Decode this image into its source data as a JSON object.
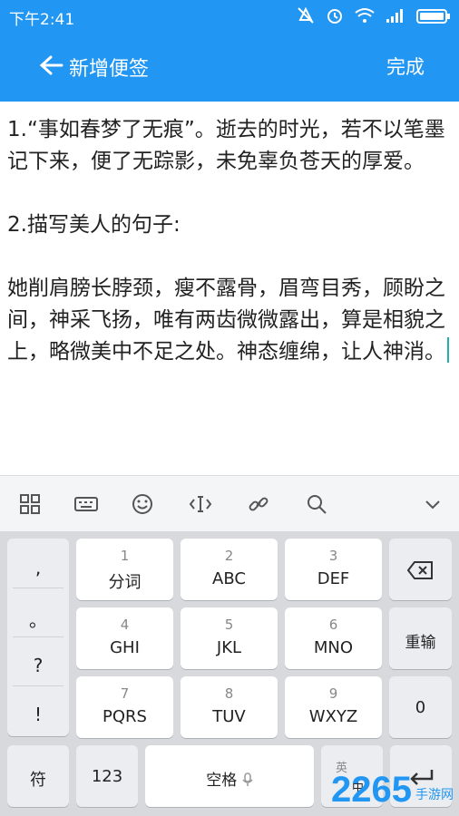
{
  "status_bar": {
    "time": "下午2:41"
  },
  "app_bar": {
    "title": "新增便签",
    "done_label": "完成"
  },
  "note": {
    "content": "1.“事如春梦了无痕”。逝去的时光，若不以笔墨记下来，便了无踪影，未免辜负苍天的厚爱。\n\n2.描写美人的句子:\n\n她削肩膀长脖颈，瘦不露骨，眉弯目秀，顾盼之间，神采飞扬，唯有两齿微微露出，算是相貌之上，略微美中不足之处。神态缠绵，让人神消。"
  },
  "keyboard": {
    "punct": [
      ",",
      "。",
      "?",
      "!"
    ],
    "rows": [
      [
        {
          "num": "1",
          "label": "分词"
        },
        {
          "num": "2",
          "label": "ABC"
        },
        {
          "num": "3",
          "label": "DEF"
        }
      ],
      [
        {
          "num": "4",
          "label": "GHI"
        },
        {
          "num": "5",
          "label": "JKL"
        },
        {
          "num": "6",
          "label": "MNO"
        }
      ],
      [
        {
          "num": "7",
          "label": "PQRS"
        },
        {
          "num": "8",
          "label": "TUV"
        },
        {
          "num": "9",
          "label": "WXYZ"
        }
      ]
    ],
    "right_keys": {
      "rerun": "重输",
      "zero": "0"
    },
    "bottom": {
      "symbols": "符",
      "num123": "123",
      "space": "空格",
      "lang_top": "英",
      "lang_bottom": "中"
    }
  },
  "watermark": {
    "brand": "2265",
    "site": "手游网"
  }
}
